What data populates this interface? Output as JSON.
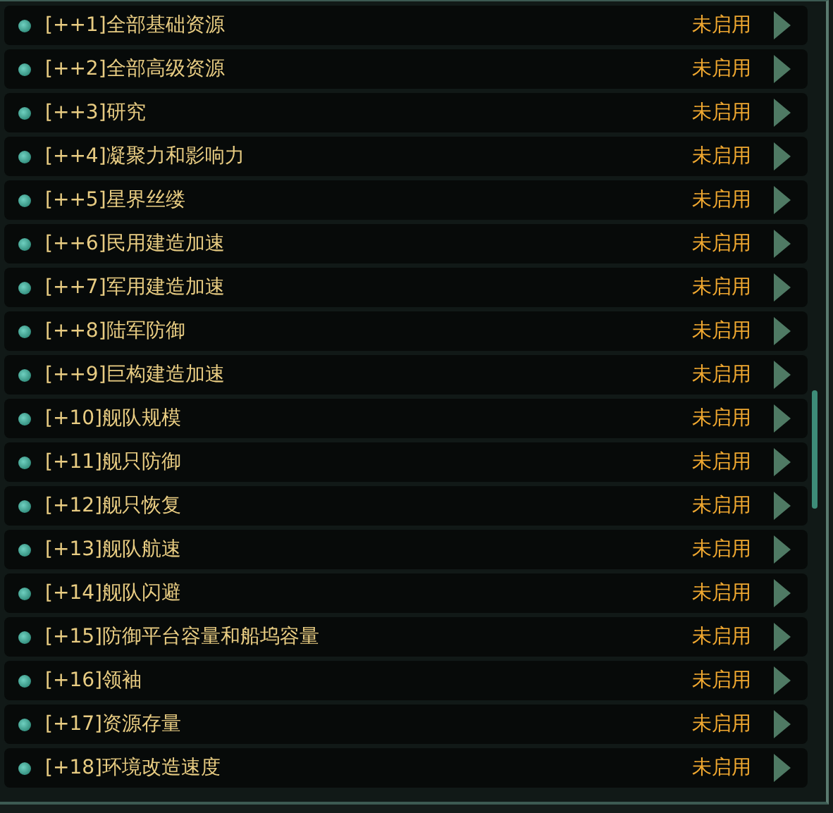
{
  "options": [
    {
      "label": "[++1]全部基础资源",
      "status": "未启用"
    },
    {
      "label": "[++2]全部高级资源",
      "status": "未启用"
    },
    {
      "label": "[++3]研究",
      "status": "未启用"
    },
    {
      "label": "[++4]凝聚力和影响力",
      "status": "未启用"
    },
    {
      "label": "[++5]星界丝缕",
      "status": "未启用"
    },
    {
      "label": "[++6]民用建造加速",
      "status": "未启用"
    },
    {
      "label": "[++7]军用建造加速",
      "status": "未启用"
    },
    {
      "label": "[++8]陆军防御",
      "status": "未启用"
    },
    {
      "label": "[++9]巨构建造加速",
      "status": "未启用"
    },
    {
      "label": "[+10]舰队规模",
      "status": "未启用"
    },
    {
      "label": "[+11]舰只防御",
      "status": "未启用"
    },
    {
      "label": "[+12]舰只恢复",
      "status": "未启用"
    },
    {
      "label": "[+13]舰队航速",
      "status": "未启用"
    },
    {
      "label": "[+14]舰队闪避",
      "status": "未启用"
    },
    {
      "label": "[+15]防御平台容量和船坞容量",
      "status": "未启用"
    },
    {
      "label": "[+16]领袖",
      "status": "未启用"
    },
    {
      "label": "[+17]资源存量",
      "status": "未启用"
    },
    {
      "label": "[+18]环境改造速度",
      "status": "未启用"
    }
  ]
}
